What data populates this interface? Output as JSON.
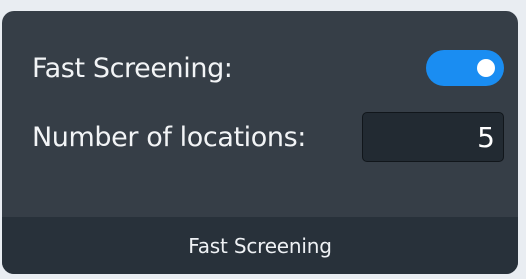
{
  "colors": {
    "panel_background": "#363e47",
    "footer_background": "#28313a",
    "toggle_active": "#1a8df2",
    "input_background": "#222a32"
  },
  "settings": {
    "fast_screening_label": "Fast Screening:",
    "fast_screening_enabled": true,
    "locations_label": "Number of locations:",
    "locations_value": "5"
  },
  "footer": {
    "title": "Fast Screening"
  }
}
